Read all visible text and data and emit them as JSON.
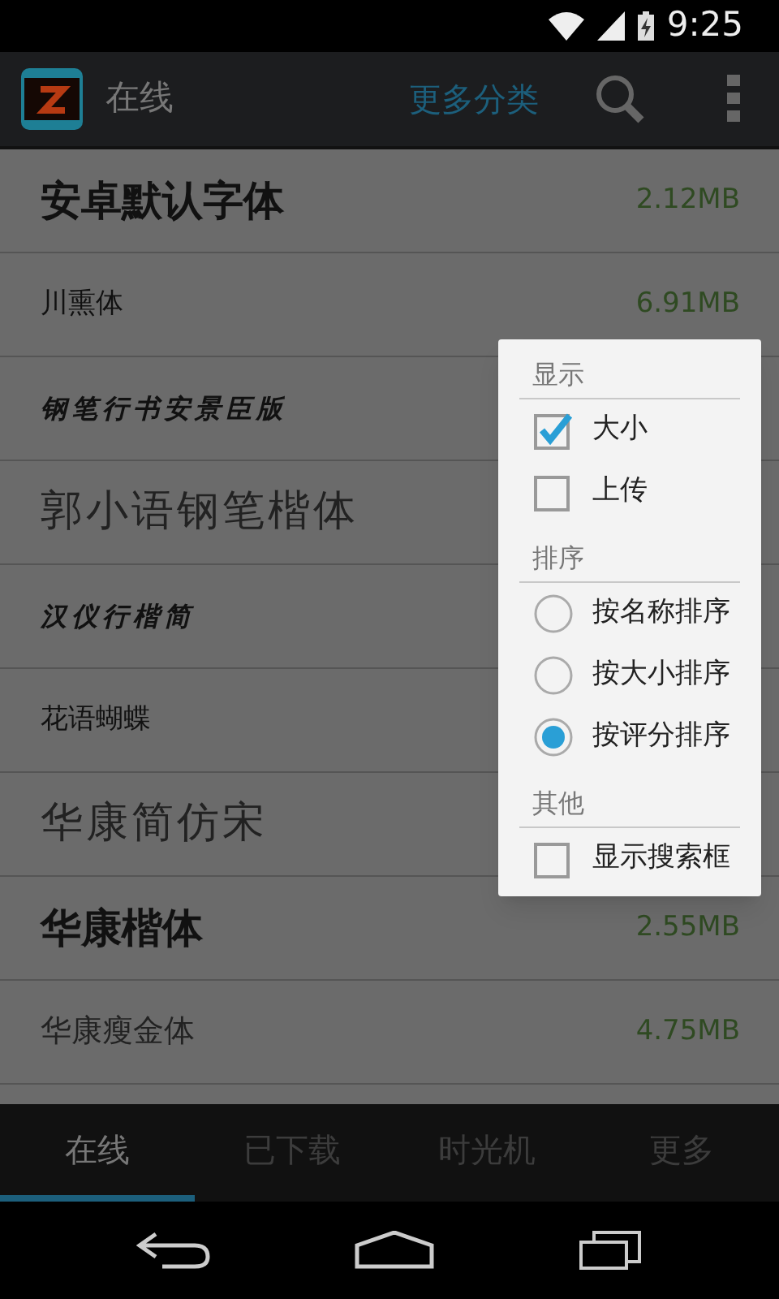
{
  "status_bar": {
    "time": "9:25"
  },
  "action_bar": {
    "title": "在线",
    "category_link": "更多分类"
  },
  "fonts": [
    {
      "name": "安卓默认字体",
      "size": "2.12MB",
      "kind": "bold"
    },
    {
      "name": "川熏体",
      "size": "6.91MB",
      "kind": "small"
    },
    {
      "name": "钢笔行书安景臣版",
      "kind": "script"
    },
    {
      "name": "郭小语钢笔楷体",
      "kind": "large"
    },
    {
      "name": "汉仪行楷简",
      "kind": "script"
    },
    {
      "name": "花语蝴蝶",
      "kind": "small"
    },
    {
      "name": "华康简仿宋",
      "kind": "large"
    },
    {
      "name": "华康楷体",
      "size": "2.55MB",
      "kind": "bold"
    },
    {
      "name": "华康瘦金体",
      "size": "4.75MB",
      "kind": "plain"
    }
  ],
  "menu": {
    "sections": [
      {
        "title": "显示",
        "items": [
          {
            "kind": "checkbox",
            "label": "大小",
            "checked": true
          },
          {
            "kind": "checkbox",
            "label": "上传",
            "checked": false
          }
        ]
      },
      {
        "title": "排序",
        "items": [
          {
            "kind": "radio",
            "label": "按名称排序",
            "selected": false
          },
          {
            "kind": "radio",
            "label": "按大小排序",
            "selected": false
          },
          {
            "kind": "radio",
            "label": "按评分排序",
            "selected": true
          }
        ]
      },
      {
        "title": "其他",
        "items": [
          {
            "kind": "checkbox",
            "label": "显示搜索框",
            "checked": false
          }
        ]
      }
    ]
  },
  "tabs": [
    {
      "label": "在线",
      "selected": true
    },
    {
      "label": "已下载",
      "selected": false
    },
    {
      "label": "时光机",
      "selected": false
    },
    {
      "label": "更多",
      "selected": false
    }
  ]
}
